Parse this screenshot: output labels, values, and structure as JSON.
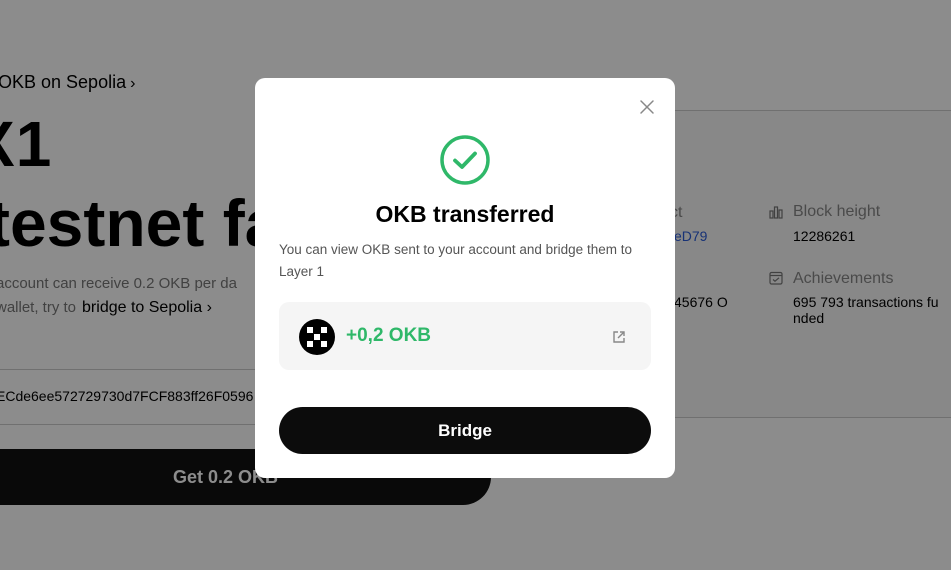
{
  "background": {
    "breadcrumb": "OKB on Sepolia",
    "breadcrumb_chevron": "›",
    "hero_line1": "X1",
    "hero_line2": "testnet fa",
    "desc_line1": "account can receive 0.2 OKB per da",
    "desc_line2_prefix": "wallet, try to",
    "desc_line2_link": "bridge to Sepolia",
    "link_chevron": "›",
    "address": "ECde6ee572729730d7FCF883ff26F0596",
    "get_button": "Get 0.2 OKB",
    "info": {
      "contract_label": "ct",
      "contract_value": "eD79",
      "balance_value": "45676 O",
      "block_height_label": "Block height",
      "block_height_value": "12286261",
      "achievements_label": "Achievements",
      "achievements_value_line1": "695 793 transactions fu",
      "achievements_value_line2": "nded"
    }
  },
  "modal": {
    "title": "OKB transferred",
    "description": "You can view OKB sent to your account and bridge them to Layer 1",
    "amount": "+0,2 OKB",
    "bridge_button": "Bridge",
    "close_icon": "close-icon",
    "success_icon": "check-circle-icon",
    "token_icon": "okx-logo-icon",
    "external_icon": "external-link-icon",
    "accent_color": "#2fb869"
  }
}
